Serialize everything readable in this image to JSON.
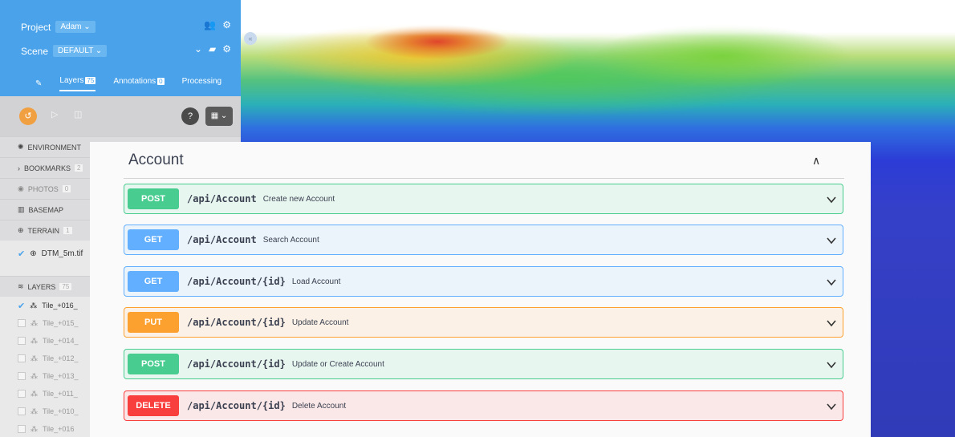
{
  "panel": {
    "project_label": "Project",
    "project_value": "Adam",
    "scene_label": "Scene",
    "scene_value": "DEFAULT",
    "tabs": [
      {
        "label": "Layers",
        "badge": "75"
      },
      {
        "label": "Annotations",
        "badge": "0"
      },
      {
        "label": "Processing",
        "badge": ""
      }
    ],
    "sections": {
      "environment": "ENVIRONMENT",
      "bookmarks": "BOOKMARKS",
      "bookmarks_count": "2",
      "photos": "PHOTOS",
      "photos_count": "0",
      "basemap": "BASEMAP",
      "terrain": "TERRAIN",
      "terrain_count": "1",
      "layers": "LAYERS",
      "layers_count": "75"
    },
    "terrain_item": "DTM_5m.tif",
    "layer_items": [
      "Tile_+016_",
      "Tile_+015_",
      "Tile_+014_",
      "Tile_+012_",
      "Tile_+013_",
      "Tile_+011_",
      "Tile_+010_",
      "Tile_+016"
    ]
  },
  "account": {
    "title": "Account",
    "operations": [
      {
        "method": "POST",
        "path": "/api/Account",
        "desc": "Create new Account"
      },
      {
        "method": "GET",
        "path": "/api/Account",
        "desc": "Search Account"
      },
      {
        "method": "GET",
        "path": "/api/Account/{id}",
        "desc": "Load Account"
      },
      {
        "method": "PUT",
        "path": "/api/Account/{id}",
        "desc": "Update Account"
      },
      {
        "method": "POST",
        "path": "/api/Account/{id}",
        "desc": "Update or Create Account"
      },
      {
        "method": "DELETE",
        "path": "/api/Account/{id}",
        "desc": "Delete Account"
      }
    ]
  },
  "colors": {
    "post": "#49cc90",
    "get": "#61affe",
    "put": "#fca130",
    "delete": "#f93e3e",
    "panel_header": "#4aa3ea"
  }
}
